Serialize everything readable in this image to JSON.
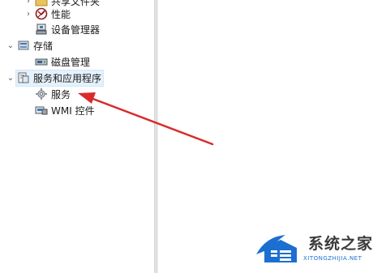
{
  "tree": {
    "items": [
      {
        "label": "共享文件夹",
        "icon": "shared-folder-icon",
        "expanded": false
      },
      {
        "label": "性能",
        "icon": "performance-icon",
        "expanded": false
      },
      {
        "label": "设备管理器",
        "icon": "device-manager-icon"
      },
      {
        "label": "存储",
        "icon": "storage-icon",
        "expanded": true
      },
      {
        "label": "磁盘管理",
        "icon": "disk-management-icon"
      },
      {
        "label": "服务和应用程序",
        "icon": "services-apps-icon",
        "expanded": true,
        "selected": true
      },
      {
        "label": "服务",
        "icon": "services-gear-icon"
      },
      {
        "label": "WMI 控件",
        "icon": "wmi-control-icon"
      }
    ]
  },
  "annotation": {
    "arrow_color": "#d92b2b"
  },
  "watermark": {
    "title": "系统之家",
    "subtitle": "XITONGZHIJIA.NET",
    "brand_color": "#1c6fd1"
  }
}
